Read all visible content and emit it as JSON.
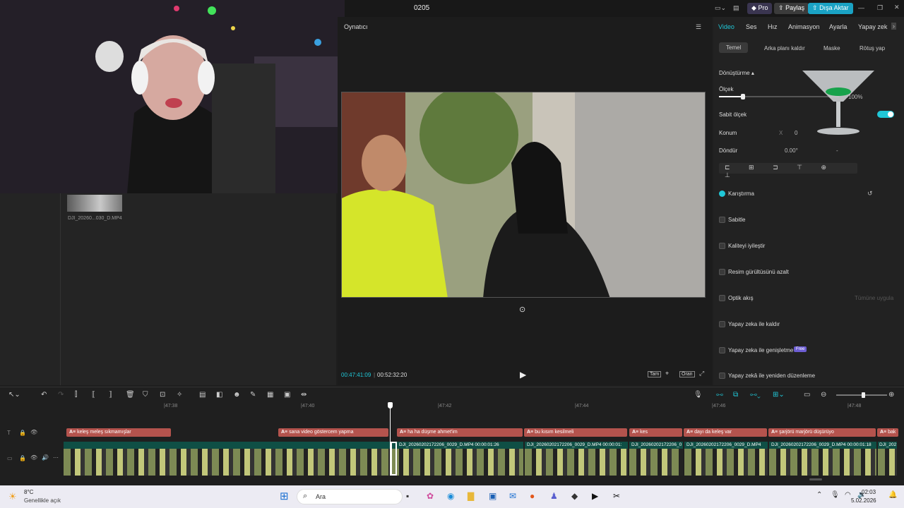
{
  "window": {
    "title": "0205",
    "pro_label": "Pro",
    "share_label": "Paylaş",
    "export_label": "Dışa Aktar"
  },
  "media": {
    "thumb_label": "DJI_20260...030_D.MP4"
  },
  "player": {
    "title": "Oynatıcı",
    "current_time": "00:47:41:09",
    "total_time": "00:52:32:20",
    "full_label": "Tam",
    "ratio_label": "Oran"
  },
  "inspector": {
    "tabs": [
      "Video",
      "Ses",
      "Hız",
      "Animasyon",
      "Ayarla",
      "Yapay zek"
    ],
    "subtabs": [
      "Temel",
      "Arka planı kaldır",
      "Maske",
      "Rötuş yap"
    ],
    "transform_label": "Dönüştürme",
    "scale_label": "Ölçek",
    "scale_value": "100%",
    "uniform_scale_label": "Sabit ölçek",
    "position_label": "Konum",
    "position_x_label": "X",
    "position_x_value": "0",
    "rotate_label": "Döndür",
    "rotate_value": "0.00°",
    "rotate_dash": "-",
    "blend_label": "Karıştırma",
    "features": [
      {
        "label": "Sabitle"
      },
      {
        "label": "Kaliteyi iyileştir"
      },
      {
        "label": "Resim gürültüsünü azalt"
      },
      {
        "label": "Optik akış",
        "extra": "Tümüne uygula"
      },
      {
        "label": "Yapay zeka ile kaldır"
      },
      {
        "label": "Yapay zeka ile genişletme",
        "badge": "Free"
      },
      {
        "label": "Yapay zekâ ile yeniden düzenleme"
      }
    ]
  },
  "timeline": {
    "ruler": [
      "|47:38",
      "|47:40",
      "|47:42",
      "|47:44",
      "|47:46",
      "|47:48"
    ],
    "captions": [
      "keleş meleş sıkmamışlar",
      "sana video göstercem yapma",
      "ha ha düşme ahmet'im",
      "bu kısım kesilmeli",
      "kes",
      "dayı da keleş var",
      "şarjörü marjörü düşürüyo",
      "bak"
    ],
    "clips": [
      "DJI_20260202172206_0029_D.MP4  00:00:01:26",
      "DJI_20260202172206_0029_D.MP4  00:00:01:",
      "DJI_20260202172206_0",
      "DJI_20260202172206_0029_D.MP4",
      "DJI_20260202172206_0029_D.MP4  00:00:01:18",
      "DJI_202"
    ]
  },
  "taskbar": {
    "weather_temp": "8°C",
    "weather_desc": "Genellikle açık",
    "search_label": "Ara",
    "time": "02:03",
    "date": "5.02.2026"
  },
  "colors": {
    "accent": "#20c7d7",
    "export": "#1aa2c4",
    "caption": "#b4534d",
    "clip_header": "#0f4f45",
    "pro": "#6c5dd3"
  }
}
